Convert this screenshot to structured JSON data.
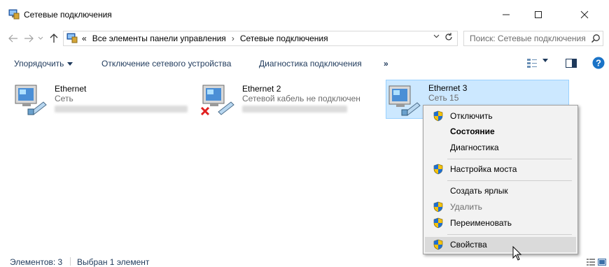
{
  "window": {
    "title": "Сетевые подключения",
    "minimize_icon": "minimize-icon",
    "maximize_icon": "maximize-icon",
    "close_icon": "close-icon"
  },
  "address": {
    "overflow": "«",
    "crumbs": [
      "Все элементы панели управления",
      "Сетевые подключения"
    ],
    "separator": "›",
    "search_placeholder": "Поиск: Сетевые подключения"
  },
  "toolbar": {
    "sort_label": "Упорядочить",
    "disable_label": "Отключение сетевого устройства",
    "diagnose_label": "Диагностика подключения",
    "more_label": "»"
  },
  "items": [
    {
      "name": "Ethernet",
      "status": "Сеть",
      "selected": false,
      "disconnected": false
    },
    {
      "name": "Ethernet 2",
      "status": "Сетевой кабель не подключен",
      "selected": false,
      "disconnected": true
    },
    {
      "name": "Ethernet 3",
      "status": "Сеть 15",
      "selected": true,
      "disconnected": false
    }
  ],
  "context_menu": {
    "items": [
      {
        "label": "Отключить",
        "shield": true,
        "bold": false,
        "disabled": false
      },
      {
        "label": "Состояние",
        "shield": false,
        "bold": true,
        "disabled": false
      },
      {
        "label": "Диагностика",
        "shield": false,
        "bold": false,
        "disabled": false
      },
      {
        "label": "Настройка моста",
        "shield": true,
        "bold": false,
        "disabled": false
      },
      {
        "label": "Создать ярлык",
        "shield": false,
        "bold": false,
        "disabled": false
      },
      {
        "label": "Удалить",
        "shield": true,
        "bold": false,
        "disabled": true
      },
      {
        "label": "Переименовать",
        "shield": true,
        "bold": false,
        "disabled": false
      },
      {
        "label": "Свойства",
        "shield": true,
        "bold": false,
        "disabled": false,
        "hover": true
      }
    ]
  },
  "status": {
    "count": "Элементов: 3",
    "selected": "Выбран 1 элемент"
  },
  "colors": {
    "accent_text": "#1e395b",
    "selection_bg": "#cce8ff",
    "selection_border": "#99d1ff",
    "menu_bg": "#f2f2f2",
    "help_blue": "#1a73c7"
  }
}
